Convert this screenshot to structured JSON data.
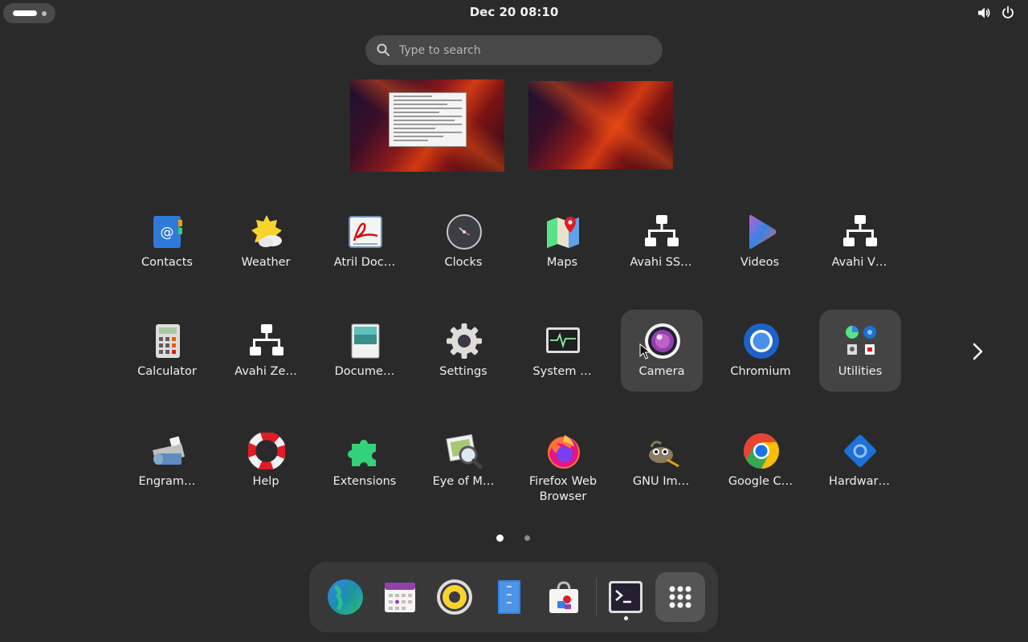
{
  "topbar": {
    "clock": "Dec 20  08:10",
    "icons": [
      "activities-indicator",
      "volume-icon",
      "power-icon"
    ]
  },
  "search": {
    "placeholder": "Type to search",
    "value": ""
  },
  "workspaces": [
    "workspace-1",
    "workspace-2"
  ],
  "apps": {
    "row1": [
      "Contacts",
      "Weather",
      "Atril Doc…",
      "Clocks",
      "Maps",
      "Avahi SS…",
      "Videos",
      "Avahi V…"
    ],
    "row2": [
      "Calculator",
      "Avahi Ze…",
      "Docume…",
      "Settings",
      "System …",
      "Camera",
      "Chromium",
      "Utilities"
    ],
    "row3": [
      "Engram…",
      "Help",
      "Extensions",
      "Eye of M…",
      "Firefox Web Browser",
      "GNU Im…",
      "Google C…",
      "Hardwar…"
    ]
  },
  "selected_app": "Camera",
  "pagination": {
    "current": 1,
    "total": 2
  },
  "dock": {
    "items": [
      "web-browser-icon",
      "calendar-icon",
      "music-player-icon",
      "text-editor-icon",
      "software-store-icon",
      "terminal-icon",
      "show-apps-icon"
    ]
  },
  "colors": {
    "background": "#2a2a2a",
    "panel": "#383838",
    "selected": "#444444",
    "accent": "#3584e4"
  }
}
